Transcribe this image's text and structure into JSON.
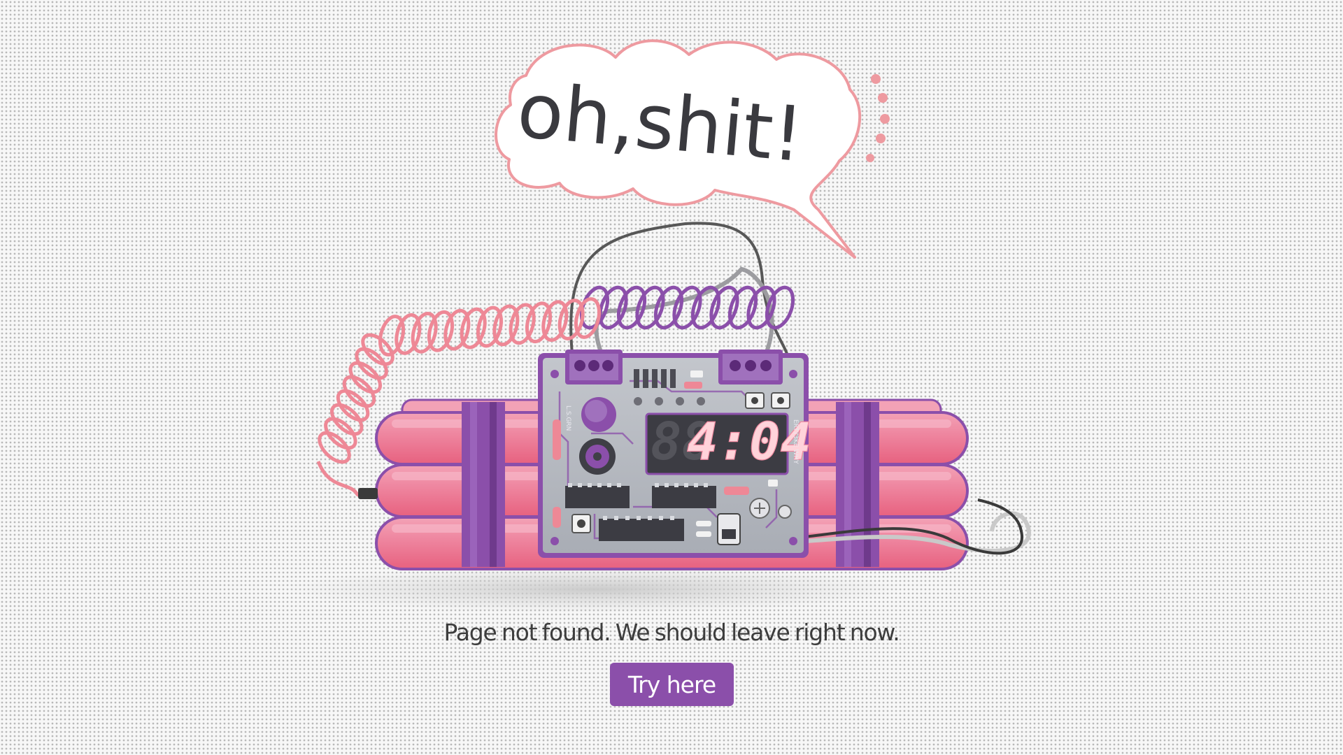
{
  "bubble": {
    "text": "oh,shit!"
  },
  "timer": {
    "display": "4:04",
    "ghost": "88"
  },
  "message": "Page not found. We should leave right now.",
  "button": {
    "label": "Try here"
  },
  "colors": {
    "accent": "#8b4faa",
    "dynamite": "#ee7a97",
    "bubble_stroke": "#ee9aa0",
    "timer_digits": "#ffd3da"
  },
  "icons": {
    "illustration": "time-bomb-icon",
    "bubble": "speech-bubble-icon"
  }
}
